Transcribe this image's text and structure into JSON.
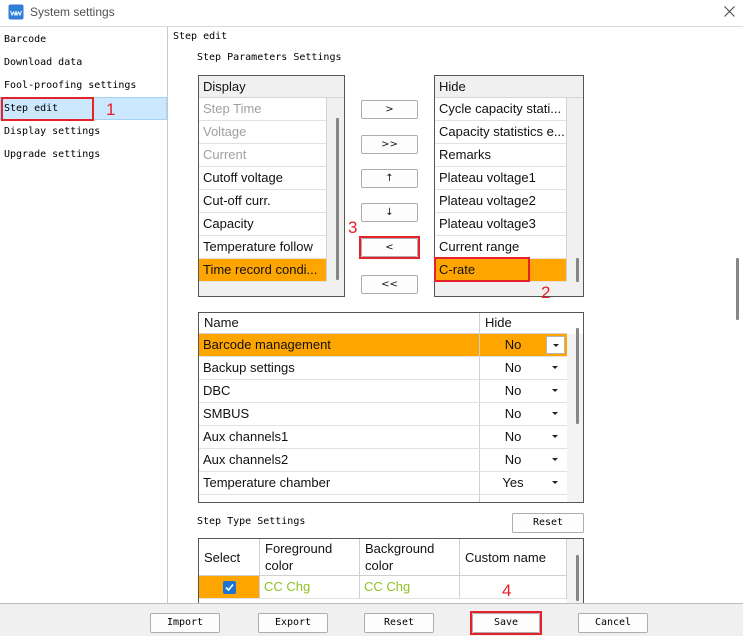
{
  "window": {
    "title": "System settings"
  },
  "colors": {
    "selection": "#FFA500",
    "annotation": "#E5212A",
    "sidebar_selected": "#CCE8FF",
    "step_color_text": "#8DC21F",
    "checkbox": "#1C72D4",
    "disabled_text": "#A0A0A0"
  },
  "icons": {
    "app": "app-logo-icon",
    "close": "close-icon",
    "dropdown": "chevron-down-icon",
    "check": "check-icon"
  },
  "sidebar": {
    "items": [
      {
        "label": "Barcode",
        "selected": false
      },
      {
        "label": "Download data",
        "selected": false
      },
      {
        "label": "Fool-proofing settings",
        "selected": false
      },
      {
        "label": "Step edit",
        "selected": true
      },
      {
        "label": "Display settings",
        "selected": false
      },
      {
        "label": "Upgrade settings",
        "selected": false
      }
    ]
  },
  "main": {
    "section_title": "Step edit",
    "step_params": {
      "title": "Step Parameters Settings",
      "display_list": {
        "header": "Display",
        "items": [
          {
            "label": "Step Time",
            "disabled": true
          },
          {
            "label": "Voltage",
            "disabled": true
          },
          {
            "label": "Current",
            "disabled": true
          },
          {
            "label": "Cutoff voltage"
          },
          {
            "label": "Cut-off curr."
          },
          {
            "label": "Capacity"
          },
          {
            "label": "Temperature follow"
          },
          {
            "label": "Time record condi...",
            "selected": true
          }
        ]
      },
      "move_buttons": {
        "move_right": ">",
        "move_all_right": ">>",
        "move_up": "↑",
        "move_down": "↓",
        "move_left": "<",
        "move_all_left": "<<"
      },
      "hide_list": {
        "header": "Hide",
        "items": [
          {
            "label": "Cycle capacity stati..."
          },
          {
            "label": "Capacity statistics e..."
          },
          {
            "label": "Remarks"
          },
          {
            "label": "Plateau voltage1"
          },
          {
            "label": "Plateau voltage2"
          },
          {
            "label": "Plateau voltage3"
          },
          {
            "label": "Current range"
          },
          {
            "label": "C-rate",
            "selected": true
          }
        ]
      }
    },
    "field_table": {
      "columns": {
        "name": "Name",
        "hide": "Hide"
      },
      "rows": [
        {
          "name": "Barcode management",
          "hide": "No",
          "selected": true
        },
        {
          "name": "Backup settings",
          "hide": "No"
        },
        {
          "name": "DBC",
          "hide": "No"
        },
        {
          "name": "SMBUS",
          "hide": "No"
        },
        {
          "name": "Aux channels1",
          "hide": "No"
        },
        {
          "name": "Aux channels2",
          "hide": "No"
        },
        {
          "name": "Temperature chamber",
          "hide": "Yes"
        }
      ]
    },
    "step_type": {
      "title": "Step Type Settings",
      "reset_label": "Reset",
      "columns": {
        "select": "Select",
        "foreground": "Foreground color",
        "background": "Background color",
        "custom_name": "Custom name"
      },
      "rows": [
        {
          "checked": true,
          "foreground": "CC Chg",
          "background": "CC Chg"
        }
      ]
    }
  },
  "footer": {
    "import": "Import",
    "export": "Export",
    "reset": "Reset",
    "save": "Save",
    "cancel": "Cancel"
  },
  "annotations": {
    "n1": "1",
    "n2": "2",
    "n3": "3",
    "n4": "4"
  }
}
